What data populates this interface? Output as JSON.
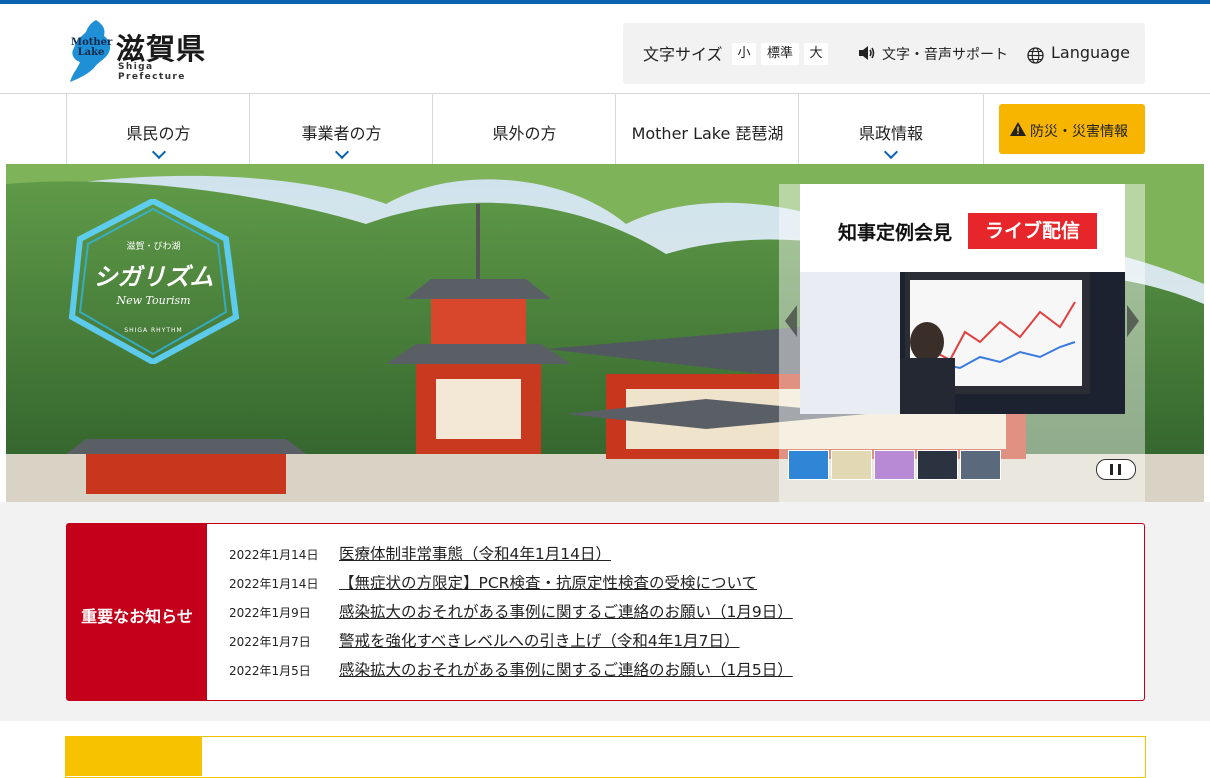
{
  "header": {
    "logo_title": "滋賀県",
    "logo_sub": "Shiga Prefecture",
    "logo_mother": "Mother Lake",
    "font_size_label": "文字サイズ",
    "font_sizes": [
      "小",
      "標準",
      "大"
    ],
    "support_label": "文字・音声サポート",
    "language_label": "Language"
  },
  "nav": {
    "items": [
      {
        "label": "県民の方",
        "has_menu": true
      },
      {
        "label": "事業者の方",
        "has_menu": true
      },
      {
        "label": "県外の方",
        "has_menu": false
      },
      {
        "label": "Mother Lake 琵琶湖",
        "has_menu": false
      },
      {
        "label": "県政情報",
        "has_menu": true
      }
    ],
    "disaster_label": "防災・災害情報"
  },
  "hero": {
    "badge_small": "滋賀・びわ湖",
    "badge_title": "シガリズム",
    "badge_sub": "New Tourism",
    "badge_foot": "SHIGA RHYTHM",
    "slide_title": "知事定例会見",
    "slide_tag": "ライブ配信"
  },
  "notices": {
    "heading": "重要なお知らせ",
    "items": [
      {
        "date": "2022年1月14日",
        "title": "医療体制非常事態（令和4年1月14日）"
      },
      {
        "date": "2022年1月14日",
        "title": "【無症状の方限定】PCR検査・抗原定性検査の受検について"
      },
      {
        "date": "2022年1月9日",
        "title": "感染拡大のおそれがある事例に関するご連絡のお願い（1月9日）"
      },
      {
        "date": "2022年1月7日",
        "title": "警戒を強化すべきレベルへの引き上げ（令和4年1月7日）"
      },
      {
        "date": "2022年1月5日",
        "title": "感染拡大のおそれがある事例に関するご連絡のお願い（1月5日）"
      }
    ]
  },
  "colors": {
    "brand_blue": "#0b63b0",
    "notice_red": "#c4001a",
    "disaster_yellow": "#f7b500"
  }
}
